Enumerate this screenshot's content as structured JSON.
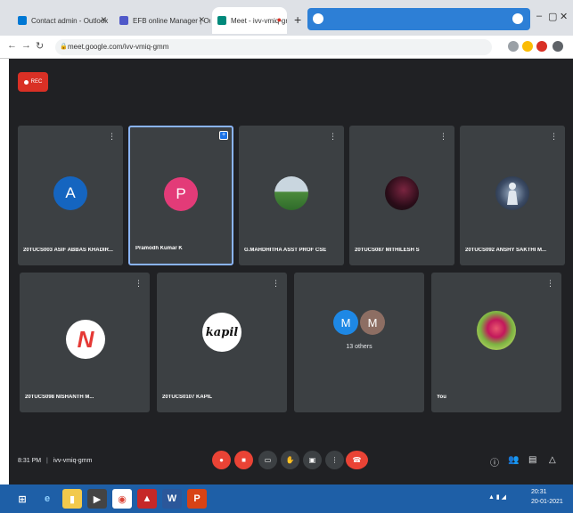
{
  "browser": {
    "tabs": [
      {
        "label": "Contact admin - Outlook",
        "active": false
      },
      {
        "label": "EFB online Manager | Outlook",
        "active": false
      },
      {
        "label": "Meet - ivv-vmiq-gmm",
        "active": true
      }
    ],
    "new_tab": "+",
    "url": "meet.google.com/ivv-vmiq-gmm"
  },
  "meet": {
    "rec_label": "REC",
    "participants": [
      {
        "name": "20TUCS003 ASIF ABBAS KHADIR...",
        "avatar_letter": "A",
        "avatar_color": "#1565c0",
        "kind": "letter"
      },
      {
        "name": "Pramodh Kumar K",
        "avatar_letter": "P",
        "avatar_color": "#e33b78",
        "kind": "letter",
        "pinned": true
      },
      {
        "name": "G.MAHDHITHA ASST PROF CSE",
        "avatar_letter": "",
        "kind": "photo-landscape"
      },
      {
        "name": "20TUCS087 MITHILESH S",
        "avatar_letter": "",
        "kind": "photo-dark"
      },
      {
        "name": "20TUCS092 ANSHY SAKTHI M...",
        "avatar_letter": "",
        "kind": "photo-figure"
      },
      {
        "name": "20TUCS098 NISHANTH M...",
        "avatar_letter": "N",
        "kind": "logo-n"
      },
      {
        "name": "20TUCS0107 KAPIL",
        "avatar_letter": "kapil",
        "kind": "logo-script"
      },
      {
        "name": "13 others",
        "avatar_letter": "M",
        "avatar_letter_2": "M",
        "kind": "others"
      },
      {
        "name": "You",
        "avatar_letter": "",
        "kind": "photo-flower"
      }
    ],
    "time": "8:31 PM",
    "meeting_code": "ivv-vmiq-gmm"
  },
  "taskbar": {
    "clock": "20:31",
    "date": "20-01-2021"
  }
}
